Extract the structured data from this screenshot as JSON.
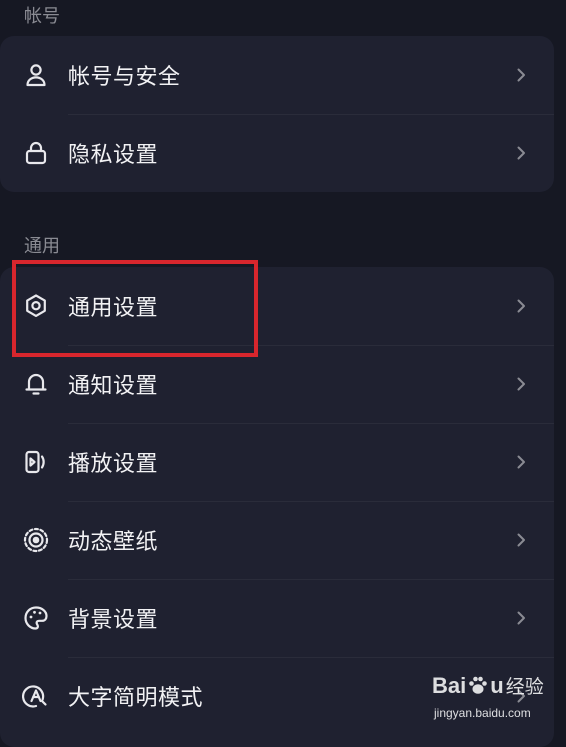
{
  "sections": [
    {
      "header": "帐号",
      "items": [
        {
          "label": "帐号与安全",
          "icon": "person-icon"
        },
        {
          "label": "隐私设置",
          "icon": "lock-icon"
        }
      ]
    },
    {
      "header": "通用",
      "items": [
        {
          "label": "通用设置",
          "icon": "gear-icon"
        },
        {
          "label": "通知设置",
          "icon": "bell-icon"
        },
        {
          "label": "播放设置",
          "icon": "play-icon"
        },
        {
          "label": "动态壁纸",
          "icon": "wallpaper-icon"
        },
        {
          "label": "背景设置",
          "icon": "palette-icon"
        },
        {
          "label": "大字简明模式",
          "icon": "large-text-icon"
        }
      ]
    }
  ],
  "highlighted_item": "通用设置",
  "colors": {
    "background": "#161823",
    "card": "#1f2130",
    "text": "#f2f2f4",
    "muted": "#8a8b93",
    "highlight": "#d8262d"
  },
  "watermark": {
    "brand_left": "Bai",
    "brand_right": "u",
    "suffix": "经验",
    "url": "jingyan.baidu.com"
  }
}
